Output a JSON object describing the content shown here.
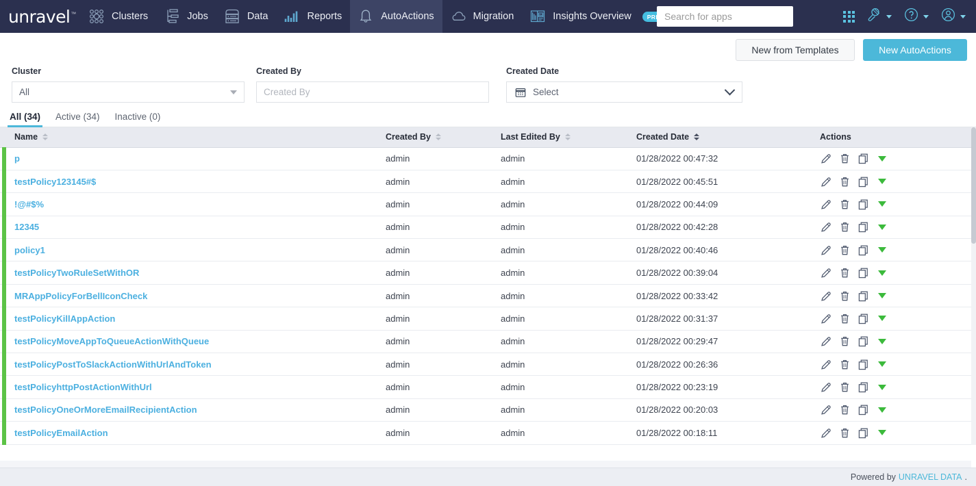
{
  "header": {
    "logo": "unravel",
    "logo_tm": "™",
    "nav": [
      {
        "label": "Clusters",
        "icon": "clusters-icon",
        "active": false
      },
      {
        "label": "Jobs",
        "icon": "jobs-icon",
        "active": false
      },
      {
        "label": "Data",
        "icon": "data-icon",
        "active": false
      },
      {
        "label": "Reports",
        "icon": "reports-icon",
        "active": false
      },
      {
        "label": "AutoActions",
        "icon": "bell-icon",
        "active": true
      },
      {
        "label": "Migration",
        "icon": "cloud-icon",
        "active": false
      },
      {
        "label": "Insights Overview",
        "icon": "insights-icon",
        "active": false,
        "badge": "PREVIEW"
      }
    ],
    "search": {
      "value": "",
      "placeholder": "Search for apps"
    },
    "right_icons": [
      {
        "name": "apps-grid-icon"
      },
      {
        "name": "tools-wrench-icon"
      },
      {
        "name": "help-question-icon"
      },
      {
        "name": "user-avatar-icon"
      }
    ]
  },
  "toolbar": {
    "new_from_templates": "New from Templates",
    "new_autoactions": "New AutoActions"
  },
  "filters": {
    "cluster": {
      "label": "Cluster",
      "value": "All"
    },
    "created_by": {
      "label": "Created By",
      "value": "",
      "placeholder": "Created By"
    },
    "created_date": {
      "label": "Created Date",
      "value": "Select"
    }
  },
  "tabs": [
    {
      "label": "All (34)",
      "active": true
    },
    {
      "label": "Active (34)",
      "active": false
    },
    {
      "label": "Inactive (0)",
      "active": false
    }
  ],
  "table": {
    "columns": [
      {
        "label": "Name",
        "sorted": false
      },
      {
        "label": "Created By",
        "sorted": false
      },
      {
        "label": "Last Edited By",
        "sorted": false
      },
      {
        "label": "Created Date",
        "sorted": true
      },
      {
        "label": "Actions",
        "sorted": null
      }
    ],
    "row_actions": [
      {
        "name": "edit-pencil-icon"
      },
      {
        "name": "delete-trash-icon"
      },
      {
        "name": "duplicate-copy-icon"
      },
      {
        "name": "status-caret-icon"
      }
    ],
    "rows": [
      {
        "name": "p",
        "created_by": "admin",
        "last_edited_by": "admin",
        "created_date": "01/28/2022 00:47:32"
      },
      {
        "name": "testPolicy123145#$",
        "created_by": "admin",
        "last_edited_by": "admin",
        "created_date": "01/28/2022 00:45:51"
      },
      {
        "name": "!@#$%",
        "created_by": "admin",
        "last_edited_by": "admin",
        "created_date": "01/28/2022 00:44:09"
      },
      {
        "name": "12345",
        "created_by": "admin",
        "last_edited_by": "admin",
        "created_date": "01/28/2022 00:42:28"
      },
      {
        "name": "policy1",
        "created_by": "admin",
        "last_edited_by": "admin",
        "created_date": "01/28/2022 00:40:46"
      },
      {
        "name": "testPolicyTwoRuleSetWithOR",
        "created_by": "admin",
        "last_edited_by": "admin",
        "created_date": "01/28/2022 00:39:04"
      },
      {
        "name": "MRAppPolicyForBellIconCheck",
        "created_by": "admin",
        "last_edited_by": "admin",
        "created_date": "01/28/2022 00:33:42"
      },
      {
        "name": "testPolicyKillAppAction",
        "created_by": "admin",
        "last_edited_by": "admin",
        "created_date": "01/28/2022 00:31:37"
      },
      {
        "name": "testPolicyMoveAppToQueueActionWithQueue",
        "created_by": "admin",
        "last_edited_by": "admin",
        "created_date": "01/28/2022 00:29:47"
      },
      {
        "name": "testPolicyPostToSlackActionWithUrlAndToken",
        "created_by": "admin",
        "last_edited_by": "admin",
        "created_date": "01/28/2022 00:26:36"
      },
      {
        "name": "testPolicyhttpPostActionWithUrl",
        "created_by": "admin",
        "last_edited_by": "admin",
        "created_date": "01/28/2022 00:23:19"
      },
      {
        "name": "testPolicyOneOrMoreEmailRecipientAction",
        "created_by": "admin",
        "last_edited_by": "admin",
        "created_date": "01/28/2022 00:20:03"
      },
      {
        "name": "testPolicyEmailAction",
        "created_by": "admin",
        "last_edited_by": "admin",
        "created_date": "01/28/2022 00:18:11"
      }
    ]
  },
  "footer": {
    "powered_by": "Powered by",
    "brand": "UNRAVEL DATA",
    "period": "."
  },
  "colors": {
    "nav_bg": "#2b304f",
    "nav_active_bg": "#3d4465",
    "accent_cyan": "#4cb8d9",
    "row_accent_green": "#5cc346",
    "link_blue": "#4cb0e0"
  }
}
